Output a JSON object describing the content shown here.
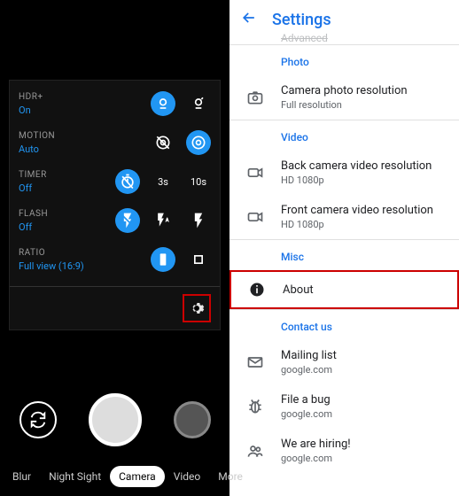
{
  "left": {
    "rows": [
      {
        "label": "HDR+",
        "value": "On"
      },
      {
        "label": "MOTION",
        "value": "Auto"
      },
      {
        "label": "TIMER",
        "value": "Off",
        "opt2": "3s",
        "opt3": "10s"
      },
      {
        "label": "FLASH",
        "value": "Off"
      },
      {
        "label": "RATIO",
        "value": "Full view (16:9)"
      }
    ],
    "modes": [
      "Blur",
      "Night Sight",
      "Camera",
      "Video",
      "More"
    ]
  },
  "right": {
    "title": "Settings",
    "truncated": "Advanced",
    "sections": {
      "photo": {
        "header": "Photo",
        "items": [
          {
            "title": "Camera photo resolution",
            "sub": "Full resolution"
          }
        ]
      },
      "video": {
        "header": "Video",
        "items": [
          {
            "title": "Back camera video resolution",
            "sub": "HD 1080p"
          },
          {
            "title": "Front camera video resolution",
            "sub": "HD 1080p"
          }
        ]
      },
      "misc": {
        "header": "Misc",
        "about": "About"
      },
      "contact": {
        "header": "Contact us",
        "items": [
          {
            "title": "Mailing list",
            "sub": "google.com"
          },
          {
            "title": "File a bug",
            "sub": "google.com"
          },
          {
            "title": "We are hiring!",
            "sub": "google.com"
          }
        ]
      }
    }
  }
}
